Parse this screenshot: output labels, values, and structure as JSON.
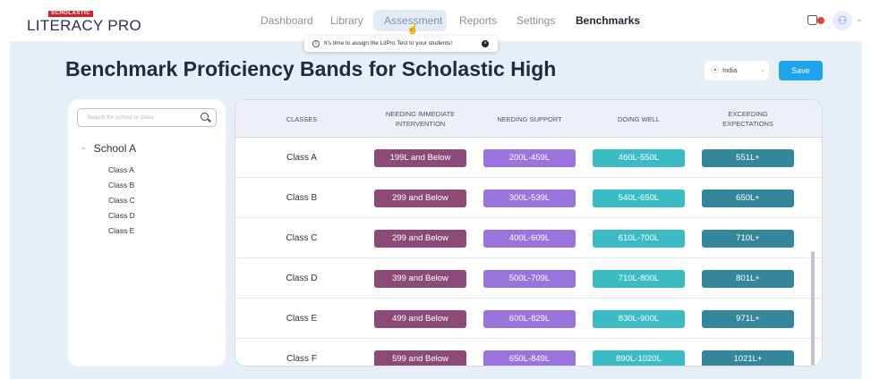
{
  "app": {
    "brand": "SCHOLASTIC",
    "product": "LITERACY PRO"
  },
  "nav": {
    "items": [
      "Dashboard",
      "Library",
      "Assessment",
      "Reports",
      "Settings",
      "Benchmarks"
    ],
    "active": "Benchmarks",
    "hovered": "Assessment",
    "notification_icon": "bell-icon",
    "user_icon": "user-icon"
  },
  "tooltip": {
    "text": "It's time to assign the LitPro Test to your students!"
  },
  "page": {
    "title": "Benchmark Proficiency Bands for Scholastic High",
    "region": "India",
    "save_label": "Save"
  },
  "sidebar": {
    "search_placeholder": "Search for school or class",
    "school": "School A",
    "classes": [
      "Class A",
      "Class B",
      "Class C",
      "Class D",
      "Class E"
    ]
  },
  "table": {
    "headers": [
      "CLASSES",
      "NEEDING IMMEDIATE INTERVENTION",
      "NEEDING SUPPORT",
      "DOING WELL",
      "EXCEEDING EXPECTATIONS"
    ],
    "rows": [
      {
        "class": "Class A",
        "bands": [
          "199L and Below",
          "200L-459L",
          "460L-550L",
          "551L+"
        ]
      },
      {
        "class": "Class B",
        "bands": [
          "299 and Below",
          "300L-539L",
          "540L-650L",
          "650L+"
        ]
      },
      {
        "class": "Class C",
        "bands": [
          "299 and Below",
          "400L-609L",
          "610L-700L",
          "710L+"
        ]
      },
      {
        "class": "Class D",
        "bands": [
          "399 and Below",
          "500L-709L",
          "710L-800L",
          "801L+"
        ]
      },
      {
        "class": "Class E",
        "bands": [
          "499 and Below",
          "600L-829L",
          "830L-900L",
          "971L+"
        ]
      },
      {
        "class": "Class F",
        "bands": [
          "599 and Below",
          "650L-849L",
          "890L-1020L",
          "1021L+"
        ]
      }
    ],
    "band_colors": [
      "#8b4a78",
      "#9a73dc",
      "#3bbcc4",
      "#34879a"
    ]
  },
  "colors": {
    "accent": "#1fa3ee",
    "background": "#e6eef8"
  }
}
